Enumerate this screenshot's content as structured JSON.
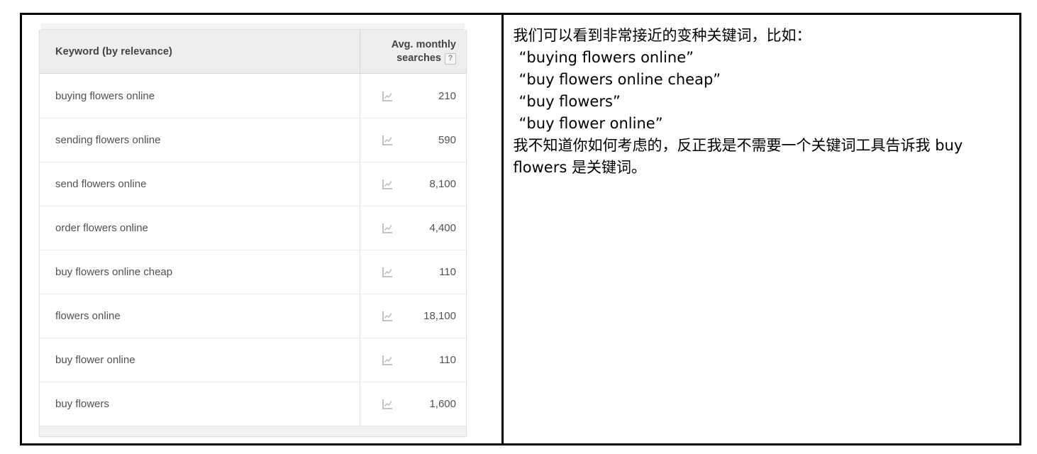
{
  "keyword_tool": {
    "table": {
      "columns": {
        "keyword_header": "Keyword (by relevance)",
        "metric_header_line1": "Avg. monthly",
        "metric_header_line2": "searches",
        "help_badge": "?"
      },
      "rows": [
        {
          "keyword": "buying flowers online",
          "icon": "trend-chart-icon",
          "avg_monthly_searches": "210"
        },
        {
          "keyword": "sending flowers online",
          "icon": "trend-chart-icon",
          "avg_monthly_searches": "590"
        },
        {
          "keyword": "send flowers online",
          "icon": "trend-chart-icon",
          "avg_monthly_searches": "8,100"
        },
        {
          "keyword": "order flowers online",
          "icon": "trend-chart-icon",
          "avg_monthly_searches": "4,400"
        },
        {
          "keyword": "buy flowers online cheap",
          "icon": "trend-chart-icon",
          "avg_monthly_searches": "110"
        },
        {
          "keyword": "flowers online",
          "icon": "trend-chart-icon",
          "avg_monthly_searches": "18,100"
        },
        {
          "keyword": "buy flower online",
          "icon": "trend-chart-icon",
          "avg_monthly_searches": "110"
        },
        {
          "keyword": "buy flowers",
          "icon": "trend-chart-icon",
          "avg_monthly_searches": "1,600"
        }
      ]
    }
  },
  "commentary": {
    "intro": "我们可以看到非常接近的变种关键词，比如：",
    "quoted_keywords": [
      "“buying flowers online”",
      "“buy flowers online cheap”",
      "“buy flowers”",
      "“buy flower online”"
    ],
    "conclusion": "我不知道你如何考虑的，反正我是不需要一个关键词工具告诉我 buy flowers 是关键词。"
  },
  "colors": {
    "frame_border": "#000000",
    "table_header_bg": "#eeeeee",
    "row_text": "#54504e",
    "icon_gray": "#bdbdbd"
  }
}
